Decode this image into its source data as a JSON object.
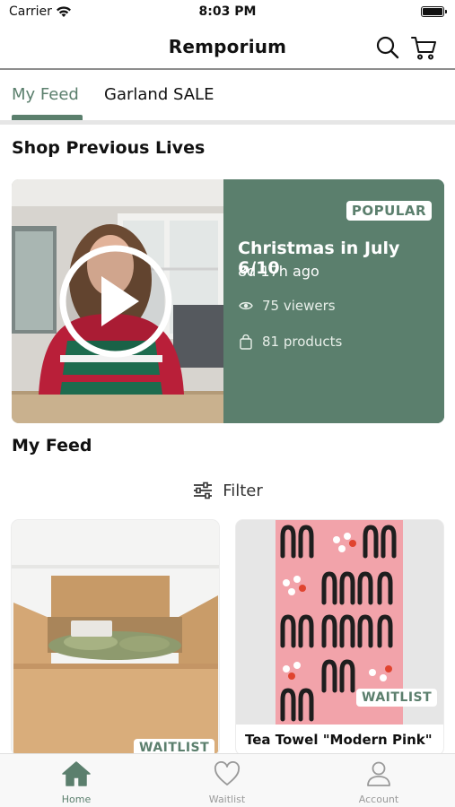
{
  "status_bar": {
    "carrier": "Carrier",
    "time": "8:03 PM"
  },
  "nav": {
    "title": "Remporium"
  },
  "tabs": [
    {
      "label": "My Feed",
      "active": true
    },
    {
      "label": "Garland SALE",
      "active": false
    }
  ],
  "previous_lives": {
    "heading": "Shop Previous Lives",
    "card": {
      "badge": "POPULAR",
      "title": "Christmas in July 6/10",
      "age": "8d 17h ago",
      "viewers": "75 viewers",
      "products": "81 products"
    }
  },
  "feed": {
    "heading": "My Feed",
    "filter_label": "Filter",
    "products": [
      {
        "badge": "WAITLIST",
        "title": ""
      },
      {
        "badge": "WAITLIST",
        "title": "Tea Towel \"Modern Pink\""
      }
    ]
  },
  "tab_bar": [
    {
      "label": "Home",
      "icon": "home-icon",
      "active": true
    },
    {
      "label": "Waitlist",
      "icon": "heart-icon",
      "active": false
    },
    {
      "label": "Account",
      "icon": "person-icon",
      "active": false
    }
  ],
  "colors": {
    "accent": "#5b7f6d",
    "badge_text": "#5b7f6d",
    "pink": "#f2a3aa"
  }
}
